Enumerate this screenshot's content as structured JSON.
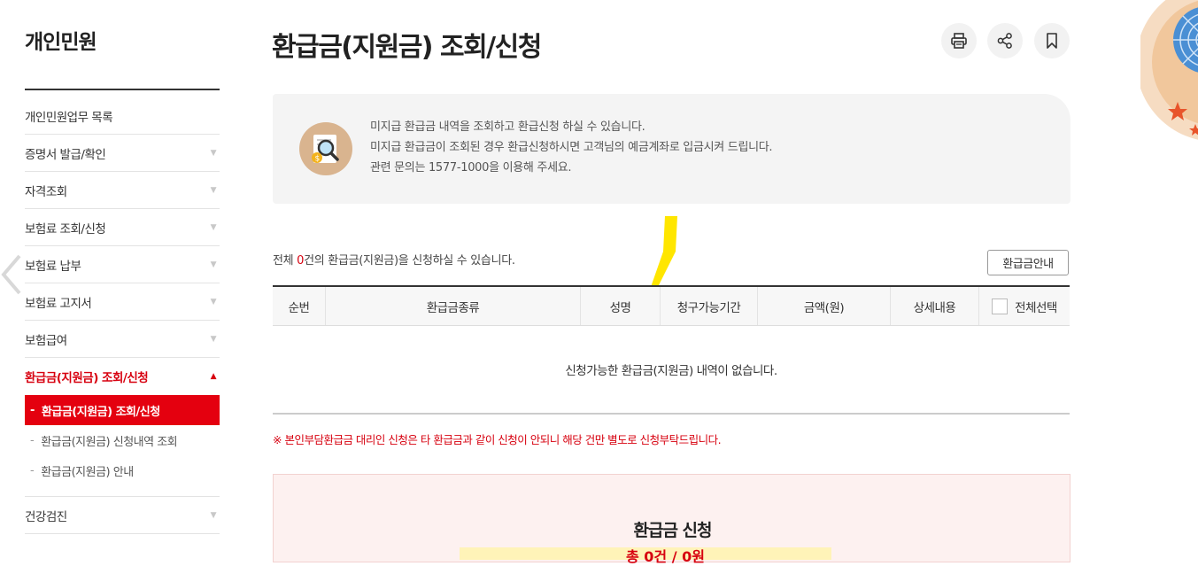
{
  "sidebar": {
    "title": "개인민원",
    "items": [
      {
        "label": "개인민원업무 목록",
        "arrow": ""
      },
      {
        "label": "증명서 발급/확인",
        "arrow": "▼"
      },
      {
        "label": "자격조회",
        "arrow": "▼"
      },
      {
        "label": "보험료 조회/신청",
        "arrow": "▼"
      },
      {
        "label": "보험료 납부",
        "arrow": "▼"
      },
      {
        "label": "보험료 고지서",
        "arrow": "▼"
      },
      {
        "label": "보험급여",
        "arrow": "▼"
      },
      {
        "label": "환급금(지원금) 조회/신청",
        "arrow": "▲"
      },
      {
        "label": "건강검진",
        "arrow": "▼"
      }
    ],
    "subitems": [
      {
        "dash": "-",
        "label": "환급금(지원금) 조회/신청"
      },
      {
        "dash": "-",
        "label": "환급금(지원금) 신청내역 조회"
      },
      {
        "dash": "-",
        "label": "환급금(지원금) 안내"
      }
    ]
  },
  "page": {
    "title": "환급금(지원금) 조회/신청",
    "tools": [
      "print-icon",
      "share-icon",
      "bookmark-icon"
    ]
  },
  "info": {
    "lines": [
      "미지급 환급금 내역을 조회하고 환급신청 하실 수 있습니다.",
      "미지급 환급금이 조회된 경우 환급신청하시면 고객님의 예금계좌로 입금시켜 드립니다.",
      "관련 문의는 1577-1000을 이용해 주세요."
    ]
  },
  "summary": {
    "prefix": "전체 ",
    "count": "0",
    "suffix": "건의 환급금(지원금)을 신청하실 수 있습니다.",
    "guide_button": "환급금안내"
  },
  "table": {
    "columns": [
      "순번",
      "환급금종류",
      "성명",
      "청구가능기간",
      "금액(원)",
      "상세내용",
      "전체선택"
    ],
    "empty_message": "신청가능한 환급금(지원금) 내역이 없습니다."
  },
  "notice": "※ 본인부담환급금 대리인 신청은 타 환급금과 같이 신청이 안되니 해당 건만 별도로 신청부탁드립니다.",
  "apply": {
    "title": "환급금 신청",
    "sub": "총 0건 / 0원"
  },
  "colors": {
    "accent": "#d7000f",
    "highlight": "#ffe600",
    "info_bg": "#f4f4f4",
    "apply_bg": "#fdf1f0"
  }
}
